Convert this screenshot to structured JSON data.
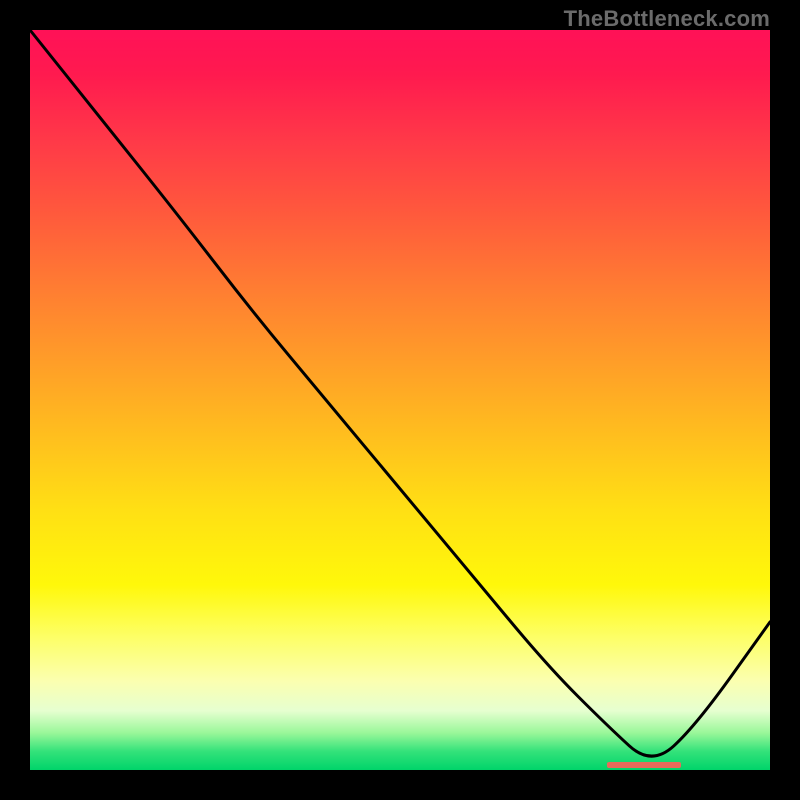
{
  "watermark": "TheBottleneck.com",
  "chart_data": {
    "type": "line",
    "title": "",
    "xlabel": "",
    "ylabel": "",
    "xlim": [
      0,
      100
    ],
    "ylim": [
      0,
      100
    ],
    "background_gradient": {
      "top_color": "#ff1157",
      "bottom_color": "#00d46a",
      "meaning": "top = high bottleneck (red), bottom = no bottleneck (green)"
    },
    "series": [
      {
        "name": "bottleneck-curve",
        "x": [
          0,
          8,
          20,
          30,
          40,
          50,
          60,
          70,
          78,
          84,
          90,
          100
        ],
        "y_pct_from_top": [
          0,
          10,
          25,
          38,
          50,
          62,
          74,
          86,
          94,
          99.5,
          94,
          80
        ],
        "optimum_x": 84
      }
    ],
    "markers": [
      {
        "name": "optimum-range",
        "x_start": 78,
        "x_end": 88,
        "y_pct_from_top": 99.3
      }
    ]
  }
}
